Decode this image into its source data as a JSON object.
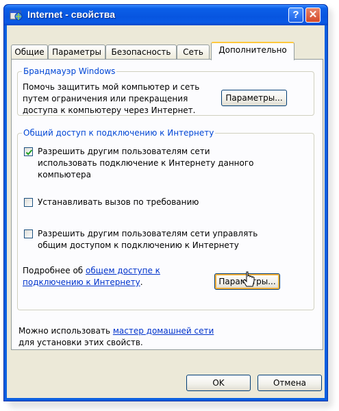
{
  "window": {
    "title": "Internet - свойства",
    "help_glyph": "?",
    "close_glyph": "✕",
    "icon": "internet-options-icon"
  },
  "tabs": [
    {
      "label": "Общие",
      "active": false
    },
    {
      "label": "Параметры",
      "active": false
    },
    {
      "label": "Безопасность",
      "active": false
    },
    {
      "label": "Сеть",
      "active": false
    },
    {
      "label": "Дополнительно",
      "active": true
    }
  ],
  "firewall": {
    "legend": "Брандмауэр Windows",
    "text": "Помочь защитить мой компьютер и сеть путем ограничения или прекращения доступа к компьютеру через Интернет.",
    "button": "Параметры..."
  },
  "ics": {
    "legend": "Общий доступ к подключению к Интернету",
    "options": [
      {
        "label": "Разрешить другим пользователям сети использовать подключение к Интернету данного компьютера",
        "checked": true
      },
      {
        "label": "Устанавливать вызов по требованию",
        "checked": false
      },
      {
        "label": "Разрешить другим пользователям сети управлять общим доступом к подключению к Интернету",
        "checked": false
      }
    ],
    "more_prefix": "Подробнее об ",
    "more_link": "общем доступе к подключению к Интернету",
    "more_suffix": ".",
    "button": "Параметры..."
  },
  "home_network": {
    "prefix": "Можно использовать ",
    "link": "мастер домашней сети",
    "suffix": " для установки этих свойств."
  },
  "footer": {
    "ok": "OK",
    "cancel": "Отмена"
  },
  "colors": {
    "titlebar": "#0755e0",
    "legend": "#0046d5",
    "link": "#0033cc",
    "active_tab_accent": "#ffc83c",
    "check": "#21a121"
  }
}
